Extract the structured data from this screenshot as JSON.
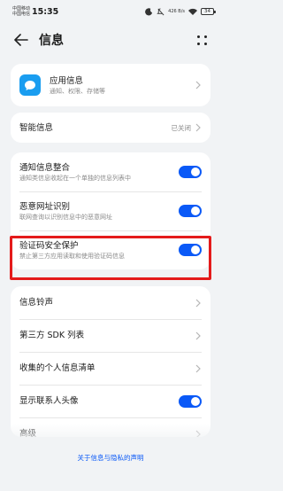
{
  "status": {
    "carrier1": "中国移动",
    "carrier2": "中国电信",
    "time": "15:35",
    "net_speed": "426 B/s",
    "battery": "34"
  },
  "header": {
    "title": "信息"
  },
  "app_info": {
    "label": "应用信息",
    "desc": "通知、权限、存储等"
  },
  "smart": {
    "label": "智能信息",
    "value": "已关闭"
  },
  "settings": [
    {
      "label": "通知信息整合",
      "desc": "通知类信息收起在一个单独的信息列表中",
      "on": true
    },
    {
      "label": "恶意网址识别",
      "desc": "联网查询以识别信息中的恶意网址",
      "on": true
    },
    {
      "label": "验证码安全保护",
      "desc": "禁止第三方应用读取和使用验证码信息",
      "on": true
    }
  ],
  "menu": [
    {
      "label": "信息铃声"
    },
    {
      "label": "第三方 SDK 列表"
    },
    {
      "label": "收集的个人信息清单"
    },
    {
      "label": "显示联系人头像",
      "on": true
    },
    {
      "label": "高级"
    }
  ],
  "footer": {
    "link": "关于信息与隐私的声明"
  },
  "colors": {
    "accent": "#0a59f7",
    "highlight": "#e41b1b",
    "app_icon": "#1a9df0"
  }
}
